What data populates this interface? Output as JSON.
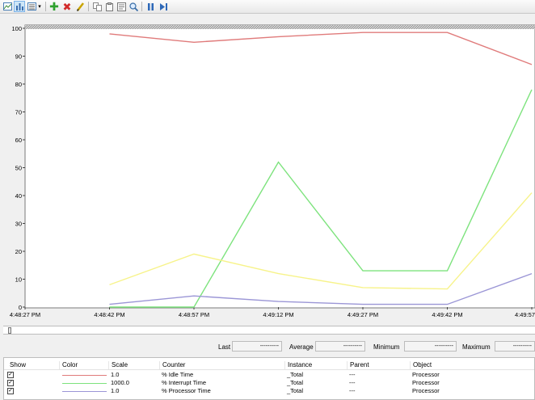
{
  "toolbar": {
    "icons": [
      "view-graph-icon",
      "view-histogram-icon",
      "view-report-icon",
      "dropdown-arrow-icon",
      "add-counter-icon",
      "delete-counter-icon",
      "highlight-icon",
      "copy-properties-icon",
      "paste-counter-list-icon",
      "properties-icon",
      "zoom-icon",
      "freeze-display-icon",
      "update-data-icon"
    ]
  },
  "chart_data": {
    "type": "line",
    "y_ticks": [
      "100",
      "90",
      "80",
      "70",
      "60",
      "50",
      "40",
      "30",
      "20",
      "10",
      "0"
    ],
    "ylim": [
      0,
      100
    ],
    "x_ticks": [
      "4:48:27 PM",
      "4:48:42 PM",
      "4:48:57 PM",
      "4:49:12 PM",
      "4:49:27 PM",
      "4:49:42 PM",
      "4:49:57"
    ],
    "x": [
      "4:48:27 PM",
      "4:48:42 PM",
      "4:48:57 PM",
      "4:49:12 PM",
      "4:49:27 PM",
      "4:49:42 PM",
      "4:49:57 PM"
    ],
    "grid": false,
    "series": [
      {
        "name": "% Idle Time",
        "color": "#e07b7b",
        "values": [
          null,
          98,
          95,
          97,
          98.5,
          98.5,
          87
        ]
      },
      {
        "name": "% Interrupt Time",
        "color": "#7de37d",
        "values": [
          null,
          0,
          0,
          52,
          13,
          13,
          78
        ]
      },
      {
        "name": "% Processor Time",
        "color": "#9b96d6",
        "values": [
          null,
          1,
          4,
          2,
          1,
          1,
          12
        ]
      },
      {
        "name": "",
        "color": "#f7f38a",
        "values": [
          null,
          8,
          19,
          12,
          7,
          6.5,
          41
        ]
      }
    ]
  },
  "stats": {
    "last_label": "Last",
    "last_value": "----------",
    "average_label": "Average",
    "average_value": "----------",
    "minimum_label": "Minimum",
    "minimum_value": "----------",
    "maximum_label": "Maximum",
    "maximum_value": "----------"
  },
  "counter_list": {
    "headers": {
      "show": "Show",
      "color": "Color",
      "scale": "Scale",
      "counter": "Counter",
      "instance": "Instance",
      "parent": "Parent",
      "object": "Object"
    },
    "rows": [
      {
        "checked": "✓",
        "color": "#e07b7b",
        "scale": "1.0",
        "counter": "% Idle Time",
        "instance": "_Total",
        "parent": "---",
        "object": "Processor"
      },
      {
        "checked": "✓",
        "color": "#7de37d",
        "scale": "1000.0",
        "counter": "% Interrupt Time",
        "instance": "_Total",
        "parent": "---",
        "object": "Processor"
      },
      {
        "checked": "✓",
        "color": "#9b96d6",
        "scale": "1.0",
        "counter": "% Processor Time",
        "instance": "_Total",
        "parent": "---",
        "object": "Processor"
      }
    ]
  }
}
